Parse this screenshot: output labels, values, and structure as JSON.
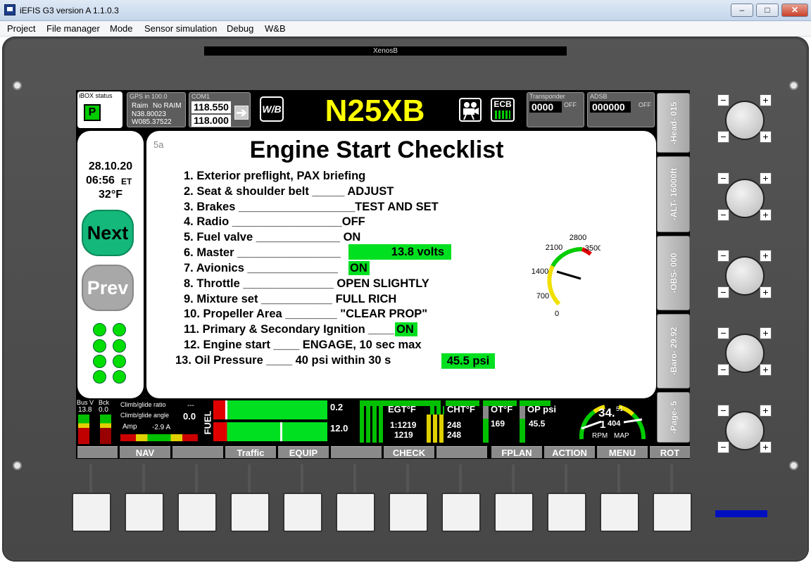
{
  "window": {
    "title": "iEFIS G3 version A 1.1.0.3",
    "minimize": "‒",
    "maximize": "□",
    "close": "✕"
  },
  "menu": [
    "Project",
    "File manager",
    "Mode",
    "Sensor simulation",
    "Debug",
    "W&B"
  ],
  "device_name": "XenosB",
  "top": {
    "ibox_label": "iBOX status",
    "ibox_value": "P",
    "gps_label": "GPS in 100.0",
    "gps_raim": "Raim",
    "gps_noraim": "No RAIM",
    "gps_lat": "N38.80023",
    "gps_lon": "W085.37522",
    "com_label": "COM1",
    "com_active": "118.550",
    "com_standby": "118.000",
    "wb": "W/B",
    "callsign": "N25XB",
    "ecb": "ECB",
    "xpdr_label": "Transponder",
    "xpdr_code": "0000",
    "xpdr_mode": "OFF",
    "adsb_label": "ADSB",
    "adsb_code": "000000",
    "adsb_mode": "OFF"
  },
  "left": {
    "date": "28.10.20",
    "time": "06:56",
    "tz": "ET",
    "temp": "32°F",
    "next": "Next",
    "prev": "Prev"
  },
  "checklist": {
    "page": "5a",
    "title": "Engine Start Checklist",
    "items": [
      "1. Exterior preflight, PAX briefing",
      "2. Seat & shoulder belt _____ ADJUST",
      "3. Brakes __________________TEST AND SET",
      "4. Radio _________________OFF",
      "5. Fuel valve _____________ ON",
      "6. Master ________________",
      "7. Avionics ______________",
      "8. Throttle ______________ OPEN SLIGHTLY",
      "9. Mixture set ___________ FULL RICH",
      "10. Propeller Area ________ \"CLEAR PROP\"",
      "11. Primary & Secondary Ignition ____",
      "12. Engine start ____ ENGAGE, 10 sec max",
      "13. Oil Pressure ____ 40 psi within 30 s"
    ],
    "master_value": "13.8 volts",
    "avionics_value": "ON",
    "ignition_value": "ON",
    "oil_value": "45.5 psi"
  },
  "rpm_gauge": {
    "ticks": [
      "0",
      "700",
      "1400",
      "2100",
      "2800",
      "3500"
    ],
    "value": 1404,
    "max": 3500
  },
  "bottom": {
    "bus_label": "Bus V",
    "bck_label": "Bck",
    "bus_value": "13.8",
    "bck_value": "0.0",
    "climb_ratio_label": "Climb/glide ratio",
    "climb_ratio_value": "---",
    "climb_angle_label": "Climb/glide angle",
    "climb_angle_value": "0.0",
    "amp_label": "Amp",
    "amp_value": "-2.9 A",
    "fuel_label": "FUEL",
    "fuel_top": "0.2",
    "fuel_bottom": "12.0",
    "egt_label": "EGT°F",
    "egt_v1": "1:1219",
    "egt_v2": "1219",
    "cht_label": "CHT°F",
    "cht_v1": "248",
    "cht_v2": "248",
    "ot_label": "OT°F",
    "ot_value": "169",
    "op_label": "OP psi",
    "op_value": "45.5",
    "map_big": "34.",
    "map_small": "51",
    "rpm_big": "1",
    "rpm_small": "404",
    "rpm_label": "RPM",
    "map_label": "MAP"
  },
  "softkeys": [
    "",
    "NAV",
    "",
    "Traffic",
    "EQUIP",
    "",
    "CHECK",
    "",
    "FPLAN",
    "ACTION",
    "MENU",
    "ROT"
  ],
  "sidekeys": [
    "-Head- 015",
    "-ALT- 16000ft",
    "-OBS- 000",
    "-Baro- 29.92",
    "-Page- 5"
  ]
}
